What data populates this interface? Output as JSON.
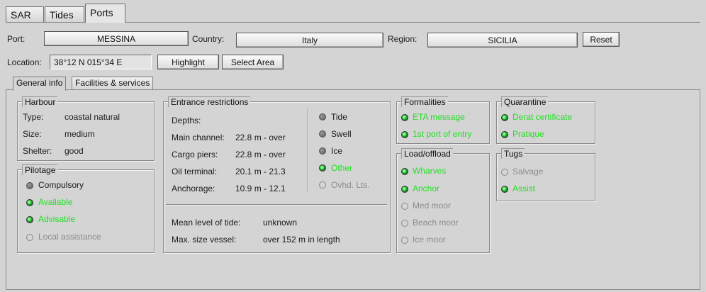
{
  "tabs": [
    "SAR",
    "Tides",
    "Ports"
  ],
  "port": {
    "label": "Port:",
    "value": "MESSINA"
  },
  "country": {
    "label": "Country:",
    "value": "Italy"
  },
  "region": {
    "label": "Region:",
    "value": "SICILIA"
  },
  "reset_label": "Reset",
  "location": {
    "label": "Location:",
    "value": "38°12 N  015°34 E"
  },
  "highlight_label": "Highlight",
  "select_area_label": "Select Area",
  "subtabs": [
    "General info",
    "Facilities & services"
  ],
  "harbour": {
    "title": "Harbour",
    "rows": [
      {
        "key": "Type:",
        "val": "coastal natural"
      },
      {
        "key": "Size:",
        "val": "medium"
      },
      {
        "key": "Shelter:",
        "val": "good"
      }
    ]
  },
  "pilotage": {
    "title": "Pilotage",
    "options": [
      {
        "label": "Compulsory",
        "state": "gray"
      },
      {
        "label": "Available",
        "state": "green"
      },
      {
        "label": "Advisable",
        "state": "green"
      },
      {
        "label": "Local assistance",
        "state": "off"
      }
    ]
  },
  "entrance": {
    "title": "Entrance restrictions",
    "depths_label": "Depths:",
    "rows": [
      {
        "key": "Main channel:",
        "val": "22.8 m - over"
      },
      {
        "key": "Cargo piers:",
        "val": "22.8 m - over"
      },
      {
        "key": "Oil terminal:",
        "val": "20.1 m - 21.3"
      },
      {
        "key": "Anchorage:",
        "val": "10.9 m - 12.1"
      }
    ],
    "options": [
      {
        "label": "Tide",
        "state": "gray"
      },
      {
        "label": "Swell",
        "state": "gray"
      },
      {
        "label": "Ice",
        "state": "gray"
      },
      {
        "label": "Other",
        "state": "green"
      },
      {
        "label": "Ovhd. Lts.",
        "state": "off"
      }
    ],
    "mean_tide": {
      "key": "Mean level of tide:",
      "val": "unknown"
    },
    "max_vessel": {
      "key": "Max. size vessel:",
      "val": "over 152 m in length"
    }
  },
  "formalities": {
    "title": "Formalities",
    "options": [
      {
        "label": "ETA message",
        "state": "green"
      },
      {
        "label": "1st port of entry",
        "state": "green"
      }
    ]
  },
  "quarantine": {
    "title": "Quarantine",
    "options": [
      {
        "label": "Derat certificate",
        "state": "green"
      },
      {
        "label": "Pratique",
        "state": "green"
      }
    ]
  },
  "loadoffload": {
    "title": "Load/offload",
    "options": [
      {
        "label": "Wharves",
        "state": "green"
      },
      {
        "label": "Anchor",
        "state": "green"
      },
      {
        "label": "Med moor",
        "state": "off"
      },
      {
        "label": "Beach moor",
        "state": "off"
      },
      {
        "label": "Ice moor",
        "state": "off"
      }
    ]
  },
  "tugs": {
    "title": "Tugs",
    "options": [
      {
        "label": "Salvage",
        "state": "off"
      },
      {
        "label": "Assist",
        "state": "green"
      }
    ]
  },
  "colors": {
    "background": "#d4d4d4",
    "active_green": "#22e022",
    "disabled_gray": "#8c8c8c"
  }
}
